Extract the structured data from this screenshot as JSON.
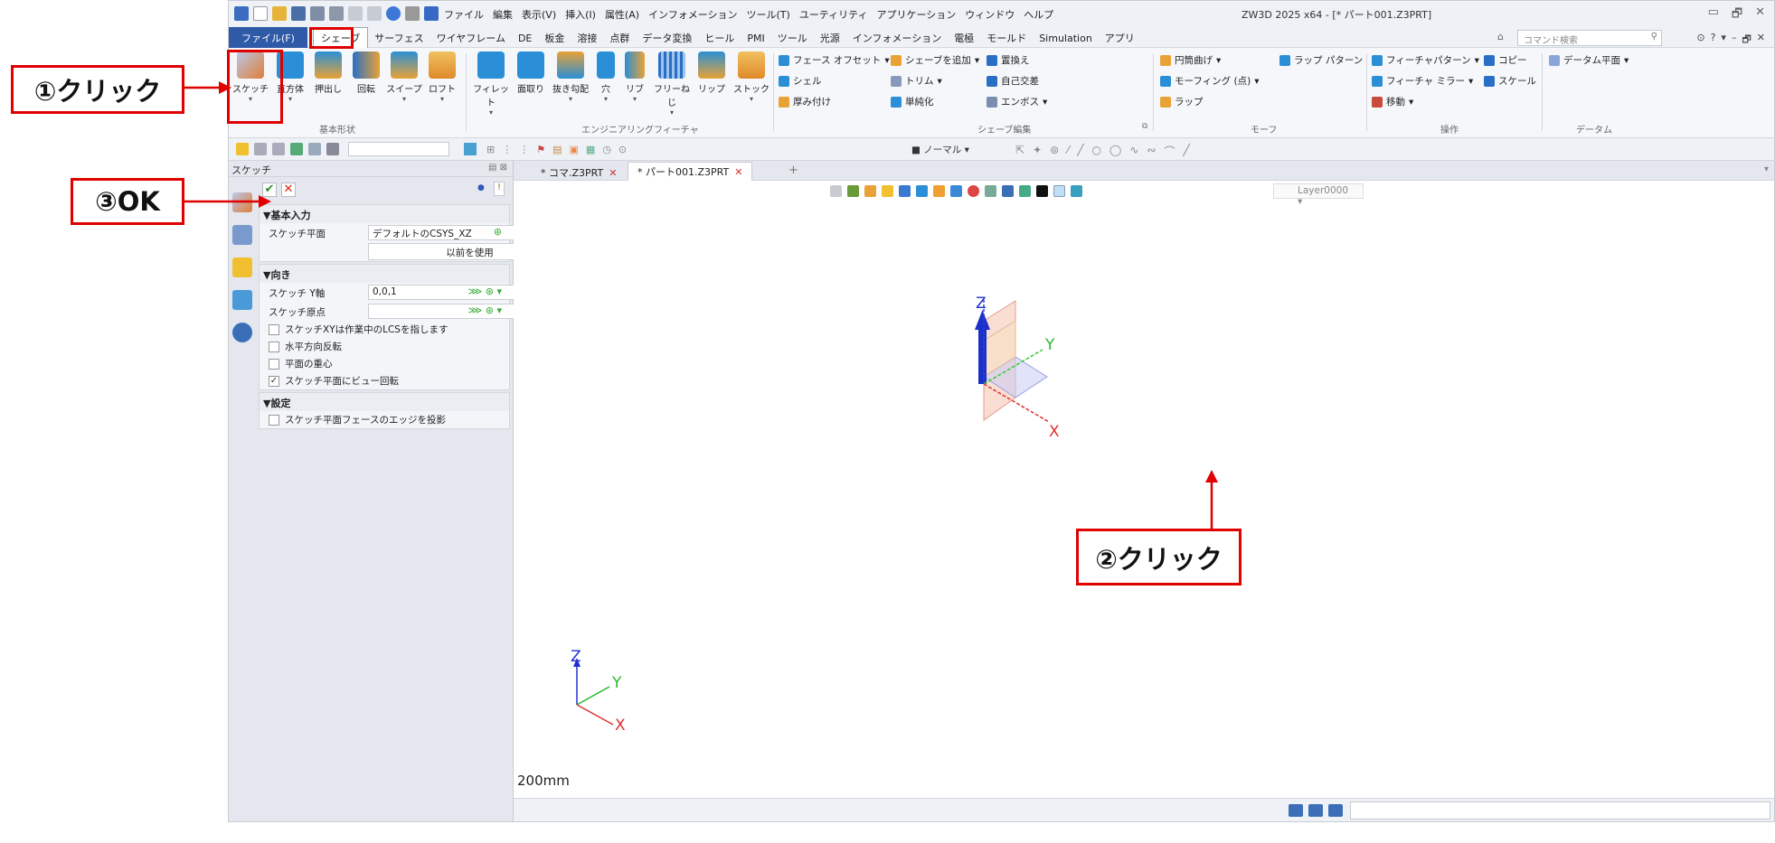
{
  "app": {
    "title": "ZW3D 2025 x64 - [* パート001.Z3PRT]",
    "menu_items": [
      "ファイル",
      "編集",
      "表示(V)",
      "挿入(I)",
      "属性(A)",
      "インフォメーション",
      "ツール(T)",
      "ユーティリティ",
      "アプリケーション",
      "ウィンドウ",
      "ヘルプ"
    ],
    "window_controls": [
      "▭",
      "🗗",
      "✕"
    ]
  },
  "ribbon_tabs": {
    "file": "ファイル(F)",
    "items": [
      "サーフェス",
      "ワイヤフレーム",
      "DE",
      "板金",
      "溶接",
      "点群",
      "データ変換",
      "ヒール",
      "PMI",
      "ツール",
      "光源",
      "インフォメーション",
      "電極",
      "モールド",
      "Simulation",
      "アプリ"
    ],
    "active": "シェーブ",
    "search_placeholder": "コマンド検索",
    "right_controls": [
      "⊙",
      "?",
      "▾",
      "–",
      "🗗",
      "✕"
    ]
  },
  "ribbon": {
    "sketch": "スケッチ",
    "basic": [
      "直方体",
      "押出し",
      "回転",
      "スイープ",
      "ロフト"
    ],
    "engineering": [
      "フィレット",
      "面取り",
      "抜き勾配",
      "穴",
      "リブ",
      "フリーねじ",
      "リップ",
      "ストック"
    ],
    "group_labels": [
      "基本形状",
      "エンジニアリングフィーチャ",
      "シェーブ編集",
      "モーフ",
      "操作",
      "データム"
    ],
    "shape_edit": [
      "フェース オフセット",
      "シェーブを追加",
      "置換え",
      "シェル",
      "トリム",
      "自己交差",
      "厚み付け",
      "単純化",
      "エンボス"
    ],
    "morph": [
      "円筒曲げ",
      "ラップ パターン",
      "モーフィング (点)",
      "ラップ"
    ],
    "ops": [
      "フィーチャパターン",
      "コピー",
      "フィーチャ ミラー",
      "スケール",
      "移動"
    ],
    "datum": "データム平面"
  },
  "toolbar": {
    "normal": "ノーマル"
  },
  "panel": {
    "title": "スケッチ",
    "ok": "✔",
    "cancel": "✕",
    "sec_basic": "▼基本入力",
    "sketch_plane_label": "スケッチ平面",
    "sketch_plane_value": "デフォルトのCSYS_XZ",
    "use_previous": "以前を使用",
    "sec_orient": "▼向き",
    "y_axis_label": "スケッチ Y軸",
    "y_axis_value": "0,0,1",
    "origin_label": "スケッチ原点",
    "origin_value": "",
    "checks": [
      {
        "label": "スケッチXYは作業中のLCSを指します",
        "checked": ""
      },
      {
        "label": "水平方向反転",
        "checked": ""
      },
      {
        "label": "平面の重心",
        "checked": ""
      },
      {
        "label": "スケッチ平面にビュー回転",
        "checked": "✓"
      }
    ],
    "sec_settings": "▼設定",
    "project_edges": "スケッチ平面フェースのエッジを投影"
  },
  "doc_tabs": [
    {
      "label": "* コマ.Z3PRT",
      "close": "✕"
    },
    {
      "label": "* パート001.Z3PRT",
      "close": "✕"
    }
  ],
  "viewport": {
    "layer": "Layer0000",
    "scale": "200mm",
    "axis_x": "X",
    "axis_y": "Y",
    "axis_z": "Z"
  },
  "callouts": {
    "c1": "①クリック",
    "c2": "②クリック",
    "c3": "③OK"
  },
  "colors": {
    "callout_red": "#e00000",
    "file_tab_blue": "#2f5aa8",
    "axis_x": "#e03030",
    "axis_y": "#2db82d",
    "axis_z": "#2030d0"
  }
}
